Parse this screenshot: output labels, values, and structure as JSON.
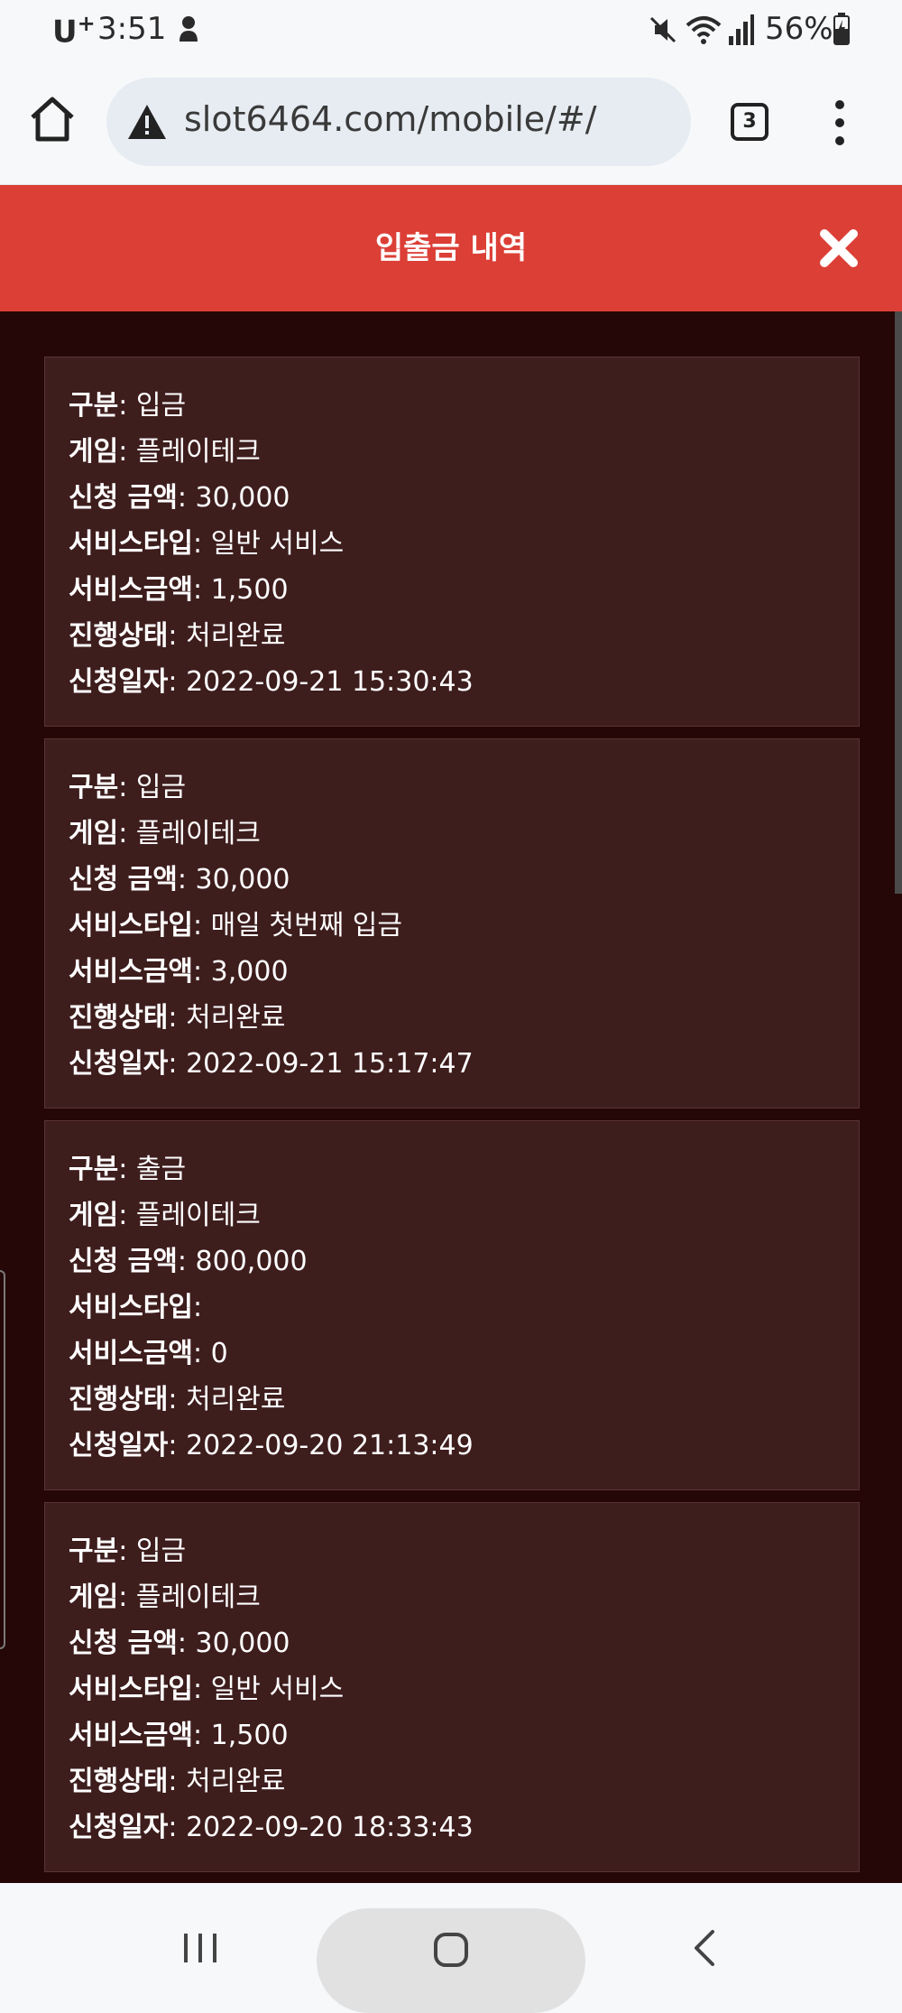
{
  "status_bar": {
    "carrier": "U",
    "carrier_sup": "+",
    "time": "3:51",
    "battery": "56%"
  },
  "browser": {
    "url": "slot6464.com/mobile/#/",
    "tab_count": "3"
  },
  "modal": {
    "title": "입출금 내역"
  },
  "labels": {
    "type": "구분",
    "game": "게임",
    "amount": "신청 금액",
    "service_type": "서비스타입",
    "service_amount": "서비스금액",
    "status": "진행상태",
    "date": "신청일자",
    "sep": ": "
  },
  "records": [
    {
      "type": "입금",
      "game": "플레이테크",
      "amount": "30,000",
      "service_type": "일반 서비스",
      "service_amount": "1,500",
      "status": "처리완료",
      "date": "2022-09-21 15:30:43"
    },
    {
      "type": "입금",
      "game": "플레이테크",
      "amount": "30,000",
      "service_type": "매일 첫번째 입금",
      "service_amount": "3,000",
      "status": "처리완료",
      "date": "2022-09-21 15:17:47"
    },
    {
      "type": "출금",
      "game": "플레이테크",
      "amount": "800,000",
      "service_type": "",
      "service_amount": "0",
      "status": "처리완료",
      "date": "2022-09-20 21:13:49"
    },
    {
      "type": "입금",
      "game": "플레이테크",
      "amount": "30,000",
      "service_type": "일반 서비스",
      "service_amount": "1,500",
      "status": "처리완료",
      "date": "2022-09-20 18:33:43"
    }
  ],
  "icons": {
    "home": "home-icon",
    "warning": "warning-icon",
    "tabs": "tabs-icon",
    "menu": "more-vert-icon",
    "close": "close-icon",
    "recents": "recents-icon",
    "nav_home": "nav-home-icon",
    "back": "back-icon"
  },
  "colors": {
    "header": "#dc3f36",
    "background": "#260707",
    "card": "#3e1d1d",
    "card_border": "#5a3434",
    "text": "#ffffff"
  }
}
